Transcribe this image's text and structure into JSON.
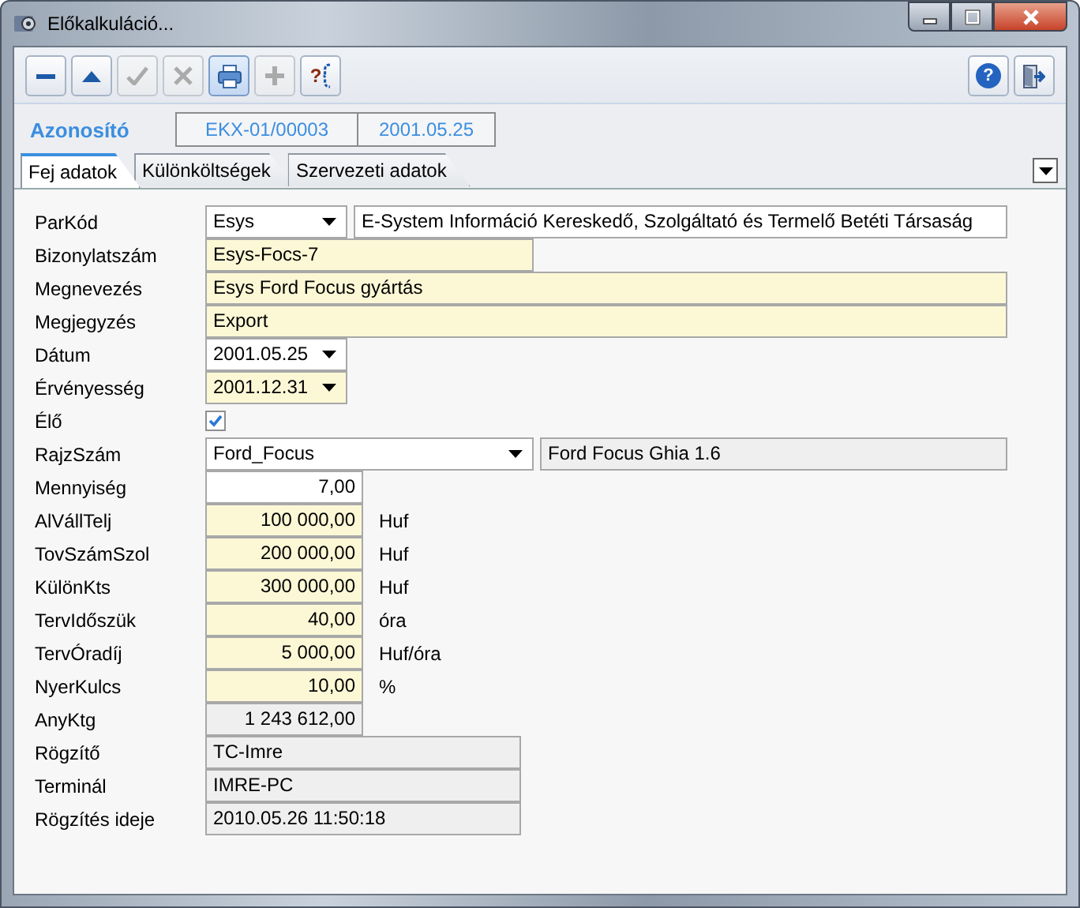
{
  "window": {
    "title": "Előkalkuláció..."
  },
  "toolbar": [
    {
      "kind": "minus",
      "disabled": false,
      "pressed": false
    },
    {
      "kind": "up",
      "disabled": false,
      "pressed": false
    },
    {
      "kind": "check",
      "disabled": true,
      "pressed": false
    },
    {
      "kind": "cross",
      "disabled": true,
      "pressed": false
    },
    {
      "kind": "print",
      "disabled": false,
      "pressed": true
    },
    {
      "kind": "plus",
      "disabled": true,
      "pressed": false
    },
    {
      "kind": "query",
      "text": "?",
      "disabled": false,
      "pressed": false
    }
  ],
  "toolbar_right": [
    {
      "kind": "help",
      "text": "?"
    },
    {
      "kind": "exit"
    }
  ],
  "header": {
    "label": "Azonosító",
    "values": [
      "EKX-01/00003",
      "2001.05.25"
    ]
  },
  "tabs": [
    {
      "label": "Fej adatok",
      "selected": true
    },
    {
      "label": "Különköltségek",
      "selected": false
    },
    {
      "label": "Szervezeti adatok",
      "selected": false
    }
  ],
  "rows": [
    {
      "label": "ParKód",
      "kind": "combo",
      "required": false,
      "readonly": false,
      "value": "Esys",
      "extra": {
        "value": "E-System Információ Kereskedő, Szolgáltató és Termelő Betéti Társaság",
        "readonly": false
      }
    },
    {
      "label": "Bizonylatszám",
      "kind": "text",
      "required": true,
      "readonly": false,
      "value": "Esys-Focs-7"
    },
    {
      "label": "Megnevezés",
      "kind": "longtext",
      "required": true,
      "readonly": false,
      "value": "Esys Ford Focus gyártás"
    },
    {
      "label": "Megjegyzés",
      "kind": "longtext",
      "required": true,
      "readonly": false,
      "value": "Export"
    },
    {
      "label": "Dátum",
      "kind": "combo",
      "required": false,
      "readonly": false,
      "value": "2001.05.25"
    },
    {
      "label": "Érvényesség",
      "kind": "combo",
      "required": true,
      "readonly": false,
      "value": "2001.12.31"
    },
    {
      "label": "Élő",
      "kind": "checkbox",
      "checked": true
    },
    {
      "label": "RajzSzám",
      "kind": "longcombo",
      "required": false,
      "readonly": false,
      "value": "Ford_Focus",
      "extra": {
        "value": "Ford Focus Ghia 1.6",
        "readonly": true
      }
    },
    {
      "label": "Mennyiség",
      "kind": "number",
      "required": false,
      "readonly": false,
      "value": "7,00"
    },
    {
      "label": "AlVállTelj",
      "kind": "number",
      "required": true,
      "readonly": false,
      "value": "100 000,00",
      "unit": "Huf"
    },
    {
      "label": "TovSzámSzol",
      "kind": "number",
      "required": true,
      "readonly": false,
      "value": "200 000,00",
      "unit": "Huf"
    },
    {
      "label": "KülönKts",
      "kind": "number",
      "required": true,
      "readonly": false,
      "value": "300 000,00",
      "unit": "Huf"
    },
    {
      "label": "TervIdőszük",
      "kind": "number",
      "required": true,
      "readonly": false,
      "value": "40,00",
      "unit": "óra"
    },
    {
      "label": "TervÓradíj",
      "kind": "number",
      "required": true,
      "readonly": false,
      "value": "5 000,00",
      "unit": "Huf/óra"
    },
    {
      "label": "NyerKulcs",
      "kind": "number",
      "required": true,
      "readonly": false,
      "value": "10,00",
      "unit": "%"
    },
    {
      "label": "AnyKtg",
      "kind": "number",
      "readonly": true,
      "value": "1 243 612,00"
    },
    {
      "label": "Rögzítő",
      "kind": "text",
      "readonly": true,
      "value": "TC-Imre"
    },
    {
      "label": "Terminál",
      "kind": "text",
      "readonly": true,
      "value": "IMRE-PC"
    },
    {
      "label": "Rögzítés ideje",
      "kind": "text",
      "readonly": true,
      "value": "2010.05.26 11:50:18"
    }
  ]
}
